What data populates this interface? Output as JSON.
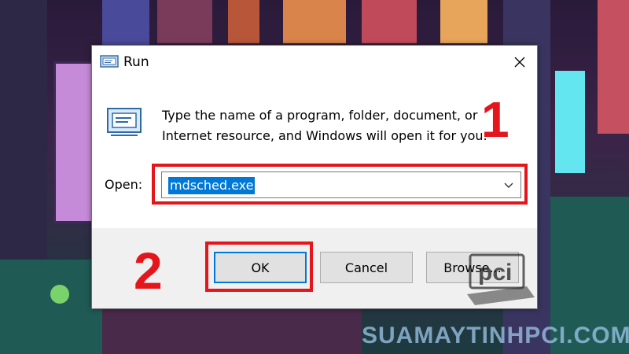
{
  "dialog": {
    "title": "Run",
    "prompt_line1": "Type the name of a program, folder, document, or",
    "prompt_line2": "Internet resource, and Windows will open it for you.",
    "open_label": "Open:",
    "open_value": "mdsched.exe"
  },
  "buttons": {
    "ok": "OK",
    "cancel": "Cancel",
    "browse": "Browse..."
  },
  "annotations": {
    "step1": "1",
    "step2": "2"
  },
  "watermark": {
    "text": "SUAMAYTINHPCI.COM",
    "logo_text": "pci"
  },
  "colors": {
    "highlight": "#e5161b",
    "selection": "#0078d7"
  },
  "icons": {
    "title": "run-app-icon",
    "close": "close-icon",
    "dropdown": "chevron-down-icon",
    "run": "run-app-icon"
  }
}
